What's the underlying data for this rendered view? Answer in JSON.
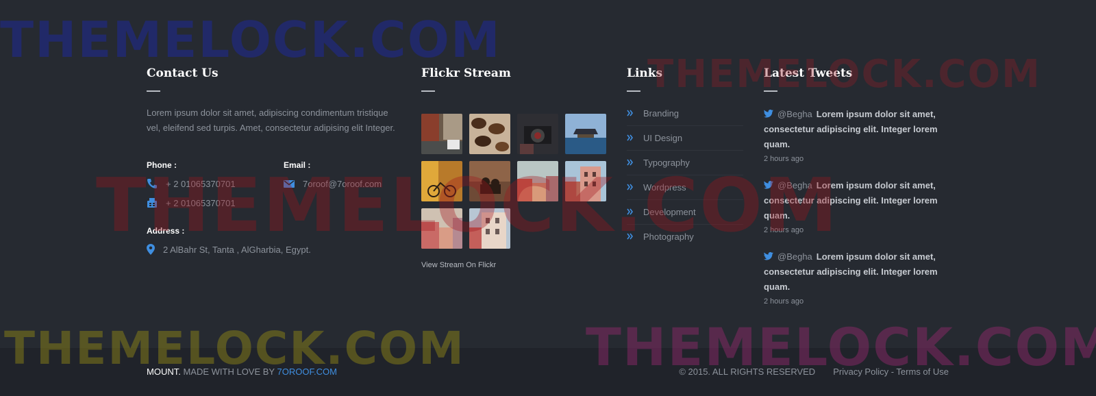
{
  "contact": {
    "title": "Contact Us",
    "description": "Lorem ipsum dolor sit amet, adipiscing condimentum tristique vel, eleifend sed turpis. Amet, consectetur adipising elit Integer.",
    "phone_label": "Phone :",
    "phone_1": "+ 2 01065370701",
    "phone_2": "+ 2 01065370701",
    "email_label": "Email :",
    "email": "7oroof@7oroof.com",
    "address_label": "Address :",
    "address": "2 AlBahr St, Tanta , AlGharbia, Egypt."
  },
  "flickr": {
    "title": "Flickr Stream",
    "photos": [
      {
        "name": "street-bicycle-photo"
      },
      {
        "name": "coffee-beans-photo"
      },
      {
        "name": "vintage-camera-photo"
      },
      {
        "name": "harbor-building-photo"
      },
      {
        "name": "autumn-bicycle-photo"
      },
      {
        "name": "couple-sunset-photo"
      },
      {
        "name": "city-street-photo"
      },
      {
        "name": "pink-building-photo"
      },
      {
        "name": "pink-street-photo"
      },
      {
        "name": "apartment-building-photo"
      }
    ],
    "link_label": "View Stream On Flickr"
  },
  "links": {
    "title": "Links",
    "items": [
      "Branding",
      "UI Design",
      "Typography",
      "Wordpress",
      "Development",
      "Photography"
    ]
  },
  "tweets": {
    "title": "Latest Tweets",
    "items": [
      {
        "handle": "@Begha",
        "text": "Lorem ipsum dolor sit amet, consectetur adipiscing elit. Integer lorem quam.",
        "time": "2 hours ago"
      },
      {
        "handle": "@Begha",
        "text": "Lorem ipsum dolor sit amet, consectetur adipiscing elit. Integer lorem quam.",
        "time": "2 hours ago"
      },
      {
        "handle": "@Begha",
        "text": "Lorem ipsum dolor sit amet, consectetur adipiscing elit. Integer lorem quam.",
        "time": "2 hours ago"
      }
    ]
  },
  "bottom": {
    "brand": "MOUNT.",
    "made_with": "MADE WITH LOVE BY",
    "credit_link": "7OROOF.COM",
    "copyright": "© 2015. ALL RIGHTS RESERVED",
    "policy_links": "Privacy Policy - Terms of Use"
  },
  "watermark": "THEMELOCK.COM",
  "colors": {
    "background": "#262a31",
    "bottom_bar": "#20232a",
    "accent": "#3f8ee0",
    "heading": "#ffffff",
    "text": "#8d939c"
  }
}
